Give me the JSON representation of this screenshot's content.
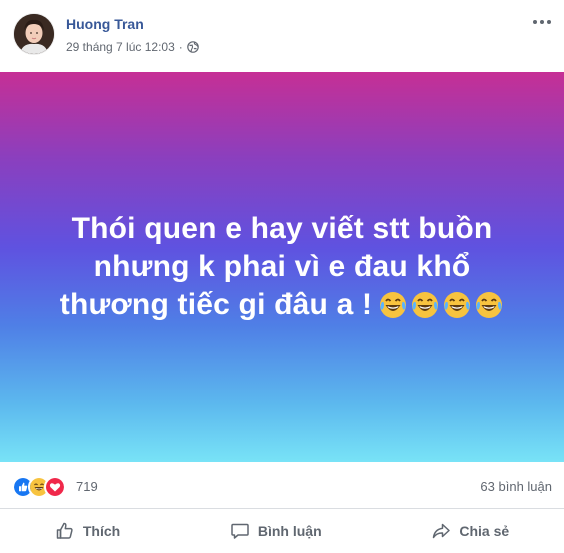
{
  "post": {
    "author": "Huong Tran",
    "timestamp": "29 tháng 7 lúc 12:03",
    "separator": "·",
    "privacy_icon": "globe-icon",
    "content_lines": [
      "Thói quen e hay viết stt buồn",
      "nhưng k phai vì e đau khổ",
      "thương tiếc gi đâu a !"
    ],
    "content_emoji": "laughing-tears-emoji",
    "background_gradient": [
      "#c62f95",
      "#5f52e0",
      "#78e3f7"
    ]
  },
  "reactions": {
    "icons": [
      "like-icon",
      "haha-icon",
      "love-icon"
    ],
    "count": "719",
    "comments": "63 bình luận"
  },
  "actions": {
    "like": "Thích",
    "comment": "Bình luận",
    "share": "Chia sẻ"
  },
  "colors": {
    "author": "#385898",
    "meta": "#616770",
    "like_blue": "#1877f2",
    "love_red": "#f0284a",
    "haha_yellow": "#f7c33f"
  }
}
